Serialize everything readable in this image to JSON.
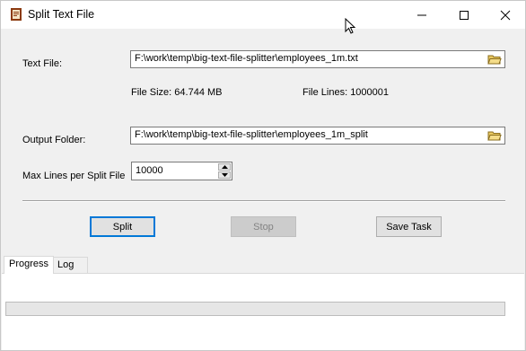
{
  "window": {
    "title": "Split Text File",
    "controls": [
      "minimize",
      "maximize",
      "close"
    ],
    "app_icon": "text-file-icon"
  },
  "form": {
    "text_file_label": "Text File:",
    "text_file_value": "F:\\work\\temp\\big-text-file-splitter\\employees_1m.txt",
    "file_size_text": "File Size: 64.744 MB",
    "file_lines_text": "File Lines: 1000001",
    "output_folder_label": "Output Folder:",
    "output_folder_value": "F:\\work\\temp\\big-text-file-splitter\\employees_1m_split",
    "max_lines_label": "Max Lines per Split File",
    "max_lines_value": "10000",
    "browse_icon": "folder-open-icon"
  },
  "buttons": {
    "split": "Split",
    "stop": "Stop",
    "save_task": "Save Task"
  },
  "tabs": [
    {
      "label": "Progress",
      "active": true
    },
    {
      "label": "Log",
      "active": false
    }
  ],
  "progress": {
    "value": 0
  },
  "colors": {
    "accent": "#0078d7",
    "progress_fill": "#06b025"
  }
}
